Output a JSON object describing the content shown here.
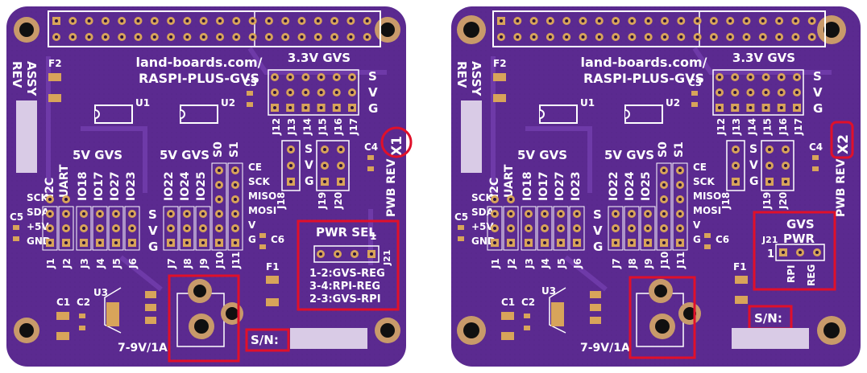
{
  "boards": [
    {
      "label_url": "land-boards.com/",
      "label_name": "RASPI-PLUS-GVS",
      "label_33v": "3.3V GVS",
      "label_5v_a": "5V GVS",
      "label_5v_b": "5V GVS",
      "assy": "ASSY",
      "rev": "REV",
      "pwb_rev": "PWB REV",
      "rev_code": "X1",
      "sn": "S/N:",
      "power_in": "7-9V/1A",
      "u1": "U1",
      "u2": "U2",
      "u3": "U3",
      "f1": "F1",
      "f2": "F2",
      "c1": "C1",
      "c2": "C2",
      "c3": "C3",
      "c4": "C4",
      "c5": "C5",
      "c6": "C6",
      "i2c": "I2C",
      "uart": "UART",
      "io18": "IO18",
      "io17": "IO17",
      "io27": "IO27",
      "io23": "IO23",
      "io22": "IO22",
      "io24": "IO24",
      "io25": "IO25",
      "s0": "S0",
      "s1": "S1",
      "sck": "SCK",
      "sda": "SDA",
      "p5v": "+5V",
      "gnd": "GND",
      "ce": "CE",
      "sck2": "SCK",
      "miso": "MISO",
      "mosi": "MOSI",
      "v": "V",
      "g": "G",
      "svg_s": "S",
      "svg_v": "V",
      "svg_g": "G",
      "jumpers_left": [
        "J1",
        "J2",
        "J3",
        "J4",
        "J5",
        "J6",
        "J7",
        "J8",
        "J9",
        "J10",
        "J11"
      ],
      "jumpers_top": [
        "J12",
        "J13",
        "J14",
        "J15",
        "J16",
        "J17"
      ],
      "j18": "J18",
      "j19": "J19",
      "j20": "J20",
      "j21": "J21",
      "pwr_sel_title": "PWR SEL",
      "pwr_sel_1": "1",
      "pwr_sel_lines": [
        "1-2:GVS-REG",
        "3-4:RPI-REG",
        "2-3:GVS-RPI"
      ]
    },
    {
      "label_url": "land-boards.com/",
      "label_name": "RASPI-PLUS-GVS",
      "label_33v": "3.3V GVS",
      "label_5v_a": "5V GVS",
      "label_5v_b": "5V GVS",
      "assy": "ASSY",
      "rev": "REV",
      "pwb_rev": "PWB REV",
      "rev_code": "X2",
      "sn": "S/N:",
      "power_in": "7-9V/1A",
      "u1": "U1",
      "u2": "U2",
      "u3": "U3",
      "f1": "F1",
      "f2": "F2",
      "c1": "C1",
      "c2": "C2",
      "c3": "C3",
      "c4": "C4",
      "c5": "C5",
      "c6": "C6",
      "i2c": "I2C",
      "uart": "UART",
      "io18": "IO18",
      "io17": "IO17",
      "io27": "IO27",
      "io23": "IO23",
      "io22": "IO22",
      "io24": "IO24",
      "io25": "IO25",
      "s0": "S0",
      "s1": "S1",
      "sck": "SCK",
      "sda": "SDA",
      "p5v": "+5V",
      "gnd": "GND",
      "ce": "CE",
      "sck2": "SCK",
      "miso": "MISO",
      "mosi": "MOSI",
      "v": "V",
      "g": "G",
      "svg_s": "S",
      "svg_v": "V",
      "svg_g": "G",
      "jumpers_left": [
        "J1",
        "J2",
        "J3",
        "J4",
        "J5",
        "J6",
        "J7",
        "J8",
        "J9",
        "J10",
        "J11"
      ],
      "jumpers_top": [
        "J12",
        "J13",
        "J14",
        "J15",
        "J16",
        "J17"
      ],
      "j18": "J18",
      "j19": "J19",
      "j20": "J20",
      "j21": "J21",
      "gvs_pwr_title_1": "GVS",
      "gvs_pwr_title_2": "PWR",
      "gvs_pwr_1": "1",
      "gvs_pwr_rpi": "RPI",
      "gvs_pwr_reg": "REG"
    }
  ],
  "colors": {
    "board": "#5b2a90",
    "board_dark": "#4a2078",
    "trace": "#6a36a4",
    "pad": "#d8a45a",
    "silk": "#ffffff",
    "highlight": "#e0102a"
  }
}
